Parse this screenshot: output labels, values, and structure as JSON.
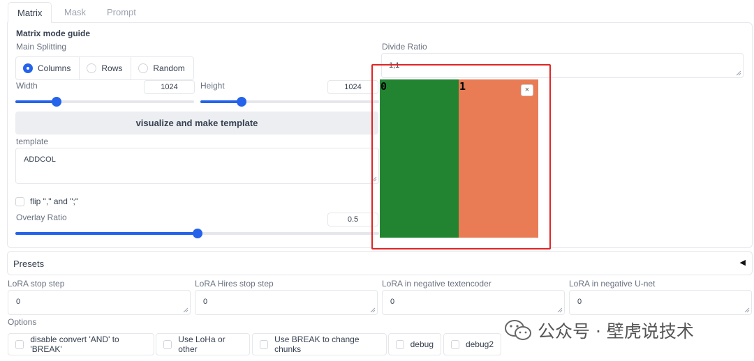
{
  "tabs": [
    "Matrix",
    "Mask",
    "Prompt"
  ],
  "matrix": {
    "guide_title": "Matrix mode guide",
    "main_splitting_label": "Main Splitting",
    "split_options": [
      "Columns",
      "Rows",
      "Random"
    ],
    "split_selected": "Columns",
    "divide_ratio_label": "Divide Ratio",
    "divide_ratio_value": "1,1",
    "width_label": "Width",
    "width_value": "1024",
    "height_label": "Height",
    "height_value": "1024",
    "visualize_button": "visualize and make template",
    "template_label": "template",
    "template_value": "ADDCOL",
    "flip_label": "flip \",\" and \";\"",
    "flip_checked": false,
    "overlay_ratio_label": "Overlay Ratio",
    "overlay_ratio_value": "0.5",
    "width_slider_fraction": 0.23,
    "height_slider_fraction": 0.23,
    "overlay_slider_fraction": 0.5
  },
  "preview": {
    "cells": [
      {
        "label": "0",
        "color": "#228431"
      },
      {
        "label": "1",
        "color": "#e97c55"
      }
    ],
    "close_symbol": "×"
  },
  "presets": {
    "label": "Presets",
    "toggle_icon": "◀"
  },
  "lora": {
    "stop_step_label": "LoRA stop step",
    "stop_step_value": "0",
    "hires_stop_step_label": "LoRA Hires stop step",
    "hires_stop_step_value": "0",
    "negative_textencoder_label": "LoRA in negative textencoder",
    "negative_textencoder_value": "0",
    "negative_unet_label": "LoRA in negative U-net",
    "negative_unet_value": "0"
  },
  "options": {
    "label": "Options",
    "items": [
      "disable convert 'AND' to 'BREAK'",
      "Use LoHa or other",
      "Use BREAK to change chunks",
      "debug",
      "debug2"
    ]
  },
  "watermark": {
    "text": "公众号 · 壁虎说技术"
  },
  "colors": {
    "accent": "#2563eb",
    "highlight_border": "#e02424"
  }
}
